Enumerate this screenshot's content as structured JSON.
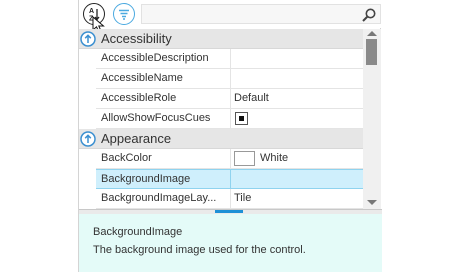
{
  "toolbar": {
    "sort_alpha_icon": "sort-alphabetical-icon",
    "sort_category_icon": "sort-categorized-icon",
    "search_placeholder": "",
    "search_icon": "magnifier-icon"
  },
  "categories": [
    {
      "label": "Accessibility",
      "properties": [
        {
          "name": "AccessibleDescription",
          "value": ""
        },
        {
          "name": "AccessibleName",
          "value": ""
        },
        {
          "name": "AccessibleRole",
          "value": "Default"
        },
        {
          "name": "AllowShowFocusCues",
          "value": "",
          "checked": true
        }
      ]
    },
    {
      "label": "Appearance",
      "properties": [
        {
          "name": "BackColor",
          "value": "White",
          "color": "#ffffff"
        },
        {
          "name": "BackgroundImage",
          "value": "",
          "selected": true
        },
        {
          "name": "BackgroundImageLay...",
          "value": "Tile"
        }
      ]
    }
  ],
  "description": {
    "title": "BackgroundImage",
    "text": "The background image used for the control."
  },
  "colors": {
    "accent": "#1e90d6",
    "selection": "#cfeffc",
    "description_bg": "#e4fbf8",
    "category_bg": "#e6e6e6"
  }
}
